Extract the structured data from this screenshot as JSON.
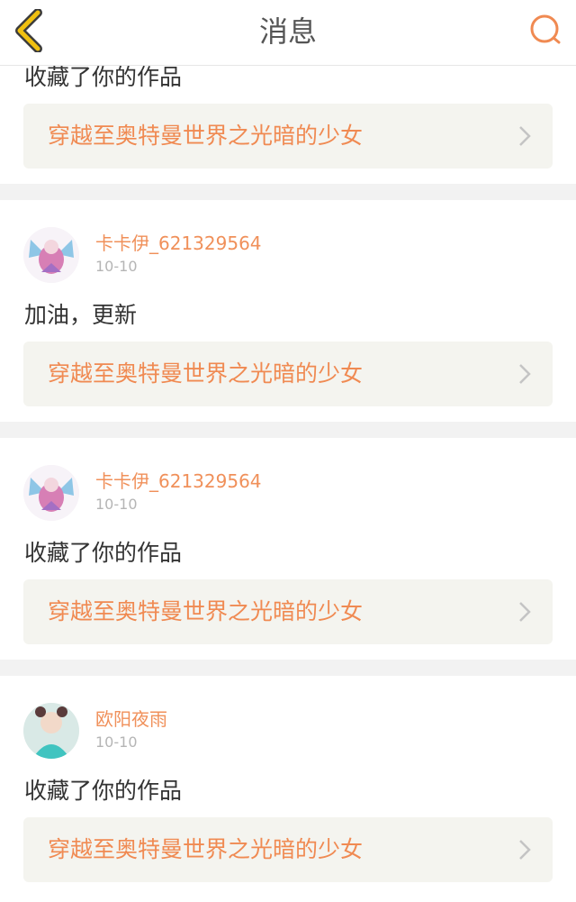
{
  "header": {
    "title": "消息"
  },
  "cards": [
    {
      "message": "收藏了你的作品",
      "work_title": "穿越至奥特曼世界之光暗的少女"
    },
    {
      "username": "卡卡伊_621329564",
      "date": "10-10",
      "message": "加油，更新",
      "work_title": "穿越至奥特曼世界之光暗的少女"
    },
    {
      "username": "卡卡伊_621329564",
      "date": "10-10",
      "message": "收藏了你的作品",
      "work_title": "穿越至奥特曼世界之光暗的少女"
    },
    {
      "username": "欧阳夜雨",
      "date": "10-10",
      "message": "收藏了你的作品",
      "work_title": "穿越至奥特曼世界之光暗的少女"
    }
  ],
  "colors": {
    "accent": "#f08a52",
    "back": "#f0c010"
  },
  "icons": {
    "back": "chevron-left-icon",
    "search": "search-icon",
    "open": "chevron-right-icon"
  }
}
